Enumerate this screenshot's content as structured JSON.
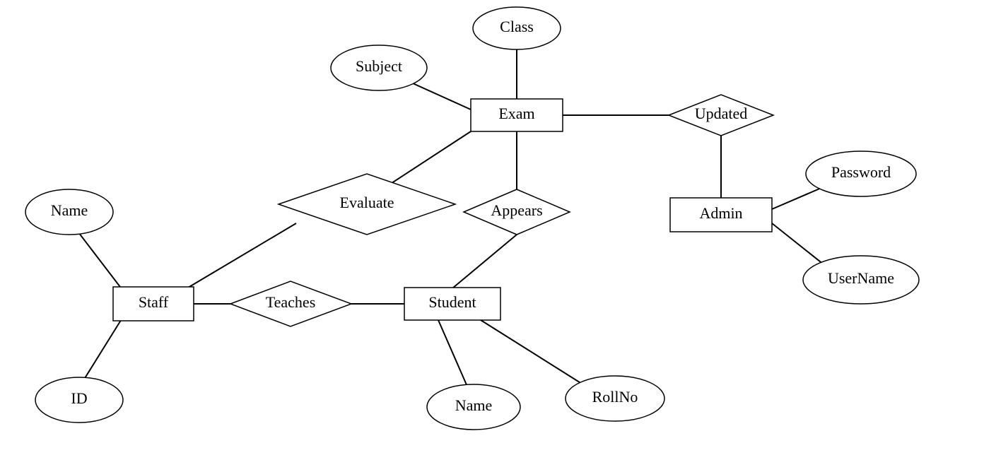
{
  "diagram": {
    "type": "entity-relationship",
    "entities": {
      "exam": {
        "label": "Exam"
      },
      "staff": {
        "label": "Staff"
      },
      "student": {
        "label": "Student"
      },
      "admin": {
        "label": "Admin"
      }
    },
    "relationships": {
      "updated": {
        "label": "Updated"
      },
      "evaluate": {
        "label": "Evaluate"
      },
      "appears": {
        "label": "Appears"
      },
      "teaches": {
        "label": "Teaches"
      }
    },
    "attributes": {
      "class": {
        "label": "Class"
      },
      "subject": {
        "label": "Subject"
      },
      "staff_name": {
        "label": "Name"
      },
      "staff_id": {
        "label": "ID"
      },
      "student_name": {
        "label": "Name"
      },
      "student_rollno": {
        "label": "RollNo"
      },
      "admin_password": {
        "label": "Password"
      },
      "admin_username": {
        "label": "UserName"
      }
    }
  }
}
